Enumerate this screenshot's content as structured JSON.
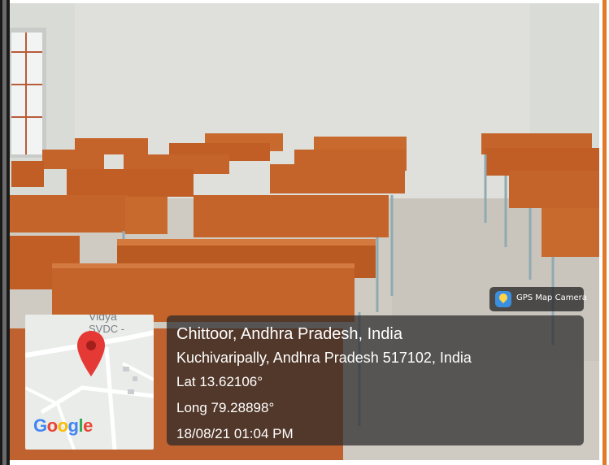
{
  "location": {
    "title": "Chittoor, Andhra Pradesh, India",
    "address": "Kuchivaripally, Andhra Pradesh 517102, India",
    "latitude": "Lat 13.62106°",
    "longitude": "Long 79.28898°",
    "datetime": "18/08/21 01:04 PM"
  },
  "badge": {
    "label": "GPS Map Camera",
    "icon": "gps-map-camera-icon"
  },
  "map": {
    "label_line1": "Vidya",
    "label_line2": "SVDC -",
    "logo": [
      "G",
      "o",
      "o",
      "g",
      "l",
      "e"
    ],
    "pin_color": "#e53935",
    "pin_icon": "map-pin-icon"
  },
  "scene": {
    "description_colors": {
      "wall": "#d9dbd6",
      "desk": "#c4642a",
      "floor": "#cfcac2",
      "frame_accent": "#e07a2a"
    }
  }
}
